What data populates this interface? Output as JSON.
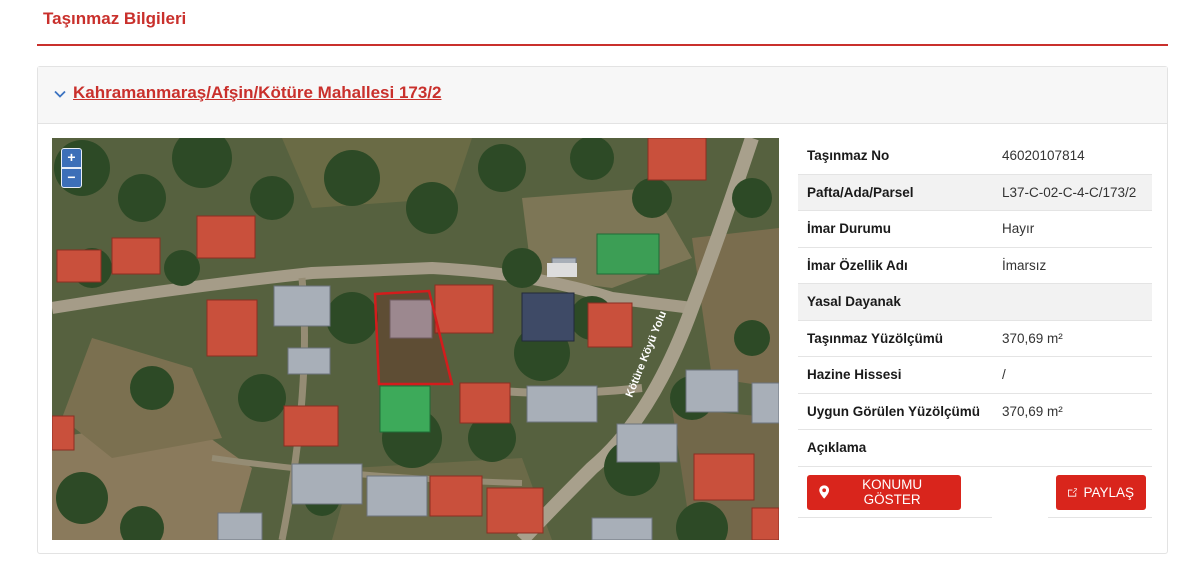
{
  "section": {
    "title": "Taşınmaz Bilgileri"
  },
  "property": {
    "link_label": "Kahramanmaraş/Afşin/Kötüre Mahallesi 173/2"
  },
  "map": {
    "zoom_in": "+",
    "zoom_out": "−",
    "road_label": "Kötüre Köyü Yolu",
    "parcel_outline_color": "#d31c1c"
  },
  "info_rows": [
    {
      "label": "Taşınmaz No",
      "value": "46020107814"
    },
    {
      "label": "Pafta/Ada/Parsel",
      "value": "L37-C-02-C-4-C/173/2"
    },
    {
      "label": "İmar Durumu",
      "value": "Hayır"
    },
    {
      "label": "İmar Özellik Adı",
      "value": "İmarsız"
    },
    {
      "label": "Yasal Dayanak",
      "value": ""
    },
    {
      "label": "Taşınmaz Yüzölçümü",
      "value": "370,69 m²"
    },
    {
      "label": "Hazine Hissesi",
      "value": "/"
    },
    {
      "label": "Uygun Görülen Yüzölçümü",
      "value": "370,69 m²"
    },
    {
      "label": "Açıklama",
      "value": ""
    }
  ],
  "actions": {
    "show_location": "KONUMU GÖSTER",
    "share": "PAYLAŞ"
  },
  "colors": {
    "accent": "#c9302c",
    "button": "#d9251c",
    "zoom_control": "#3c6fb8"
  },
  "icons": {
    "header_toggle": "chevron-down-icon",
    "show_location": "map-marker-icon",
    "share": "share-icon"
  }
}
